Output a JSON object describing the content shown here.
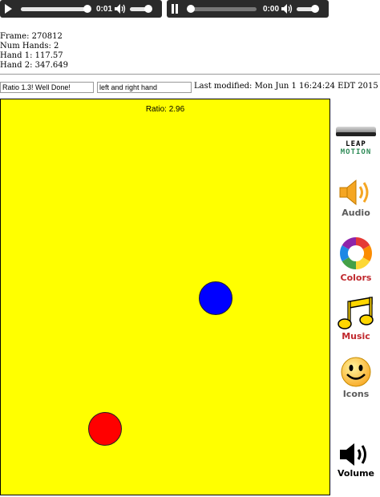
{
  "players": [
    {
      "time": "0:01",
      "progress": 0.3,
      "state": "paused"
    },
    {
      "time": "0:00",
      "progress": 0.0,
      "state": "playing"
    }
  ],
  "stats": {
    "frame": "Frame: 270812",
    "num_hands": "Num Hands: 2",
    "hand1": "Hand 1: 117.57",
    "hand2": "Hand 2: 347.649"
  },
  "controls": {
    "ratio_field": "Ratio 1.3! Well Done!",
    "hands_field": "left and right hand",
    "last_modified": "Last modified: Mon Jun 1 16:24:24 EDT 2015"
  },
  "stage": {
    "ratio_label": "Ratio: 2.96",
    "background": "#ffff00",
    "balls": [
      {
        "color": "#0000ff"
      },
      {
        "color": "#ff0000"
      }
    ]
  },
  "toolbar": {
    "leap_line1": "LEAP",
    "leap_line2": "MOTION",
    "audio": "Audio",
    "colors": "Colors",
    "music": "Music",
    "icons": "Icons",
    "volume": "Volume",
    "label_colors": {
      "audio": "#5b5b5b",
      "colors": "#c0282d",
      "music": "#c0282d",
      "icons": "#5b5b5b",
      "volume": "#000000",
      "motion": "#2e8b57"
    }
  }
}
